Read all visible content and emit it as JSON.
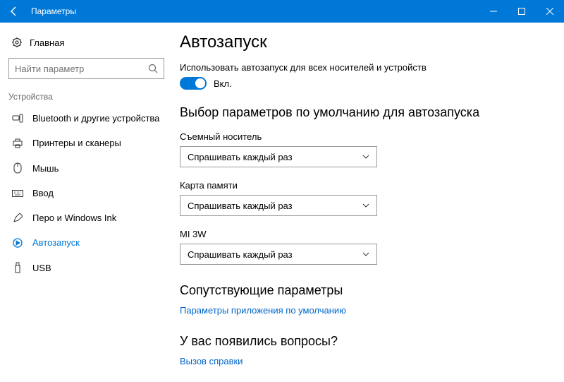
{
  "window": {
    "title": "Параметры"
  },
  "sidebar": {
    "home": "Главная",
    "search_placeholder": "Найти параметр",
    "category": "Устройства",
    "items": [
      {
        "label": "Bluetooth и другие устройства"
      },
      {
        "label": "Принтеры и сканеры"
      },
      {
        "label": "Мышь"
      },
      {
        "label": "Ввод"
      },
      {
        "label": "Перо и Windows Ink"
      },
      {
        "label": "Автозапуск"
      },
      {
        "label": "USB"
      }
    ]
  },
  "main": {
    "title": "Автозапуск",
    "toggle_desc": "Использовать автозапуск для всех носителей и устройств",
    "toggle_state": "Вкл.",
    "defaults_heading": "Выбор параметров по умолчанию для автозапуска",
    "fields": [
      {
        "label": "Съемный носитель",
        "value": "Спрашивать каждый раз"
      },
      {
        "label": "Карта памяти",
        "value": "Спрашивать каждый раз"
      },
      {
        "label": "MI 3W",
        "value": "Спрашивать каждый раз"
      }
    ],
    "related_heading": "Сопутствующие параметры",
    "related_link": "Параметры приложения по умолчанию",
    "help_heading": "У вас появились вопросы?",
    "help_link": "Вызов справки"
  }
}
